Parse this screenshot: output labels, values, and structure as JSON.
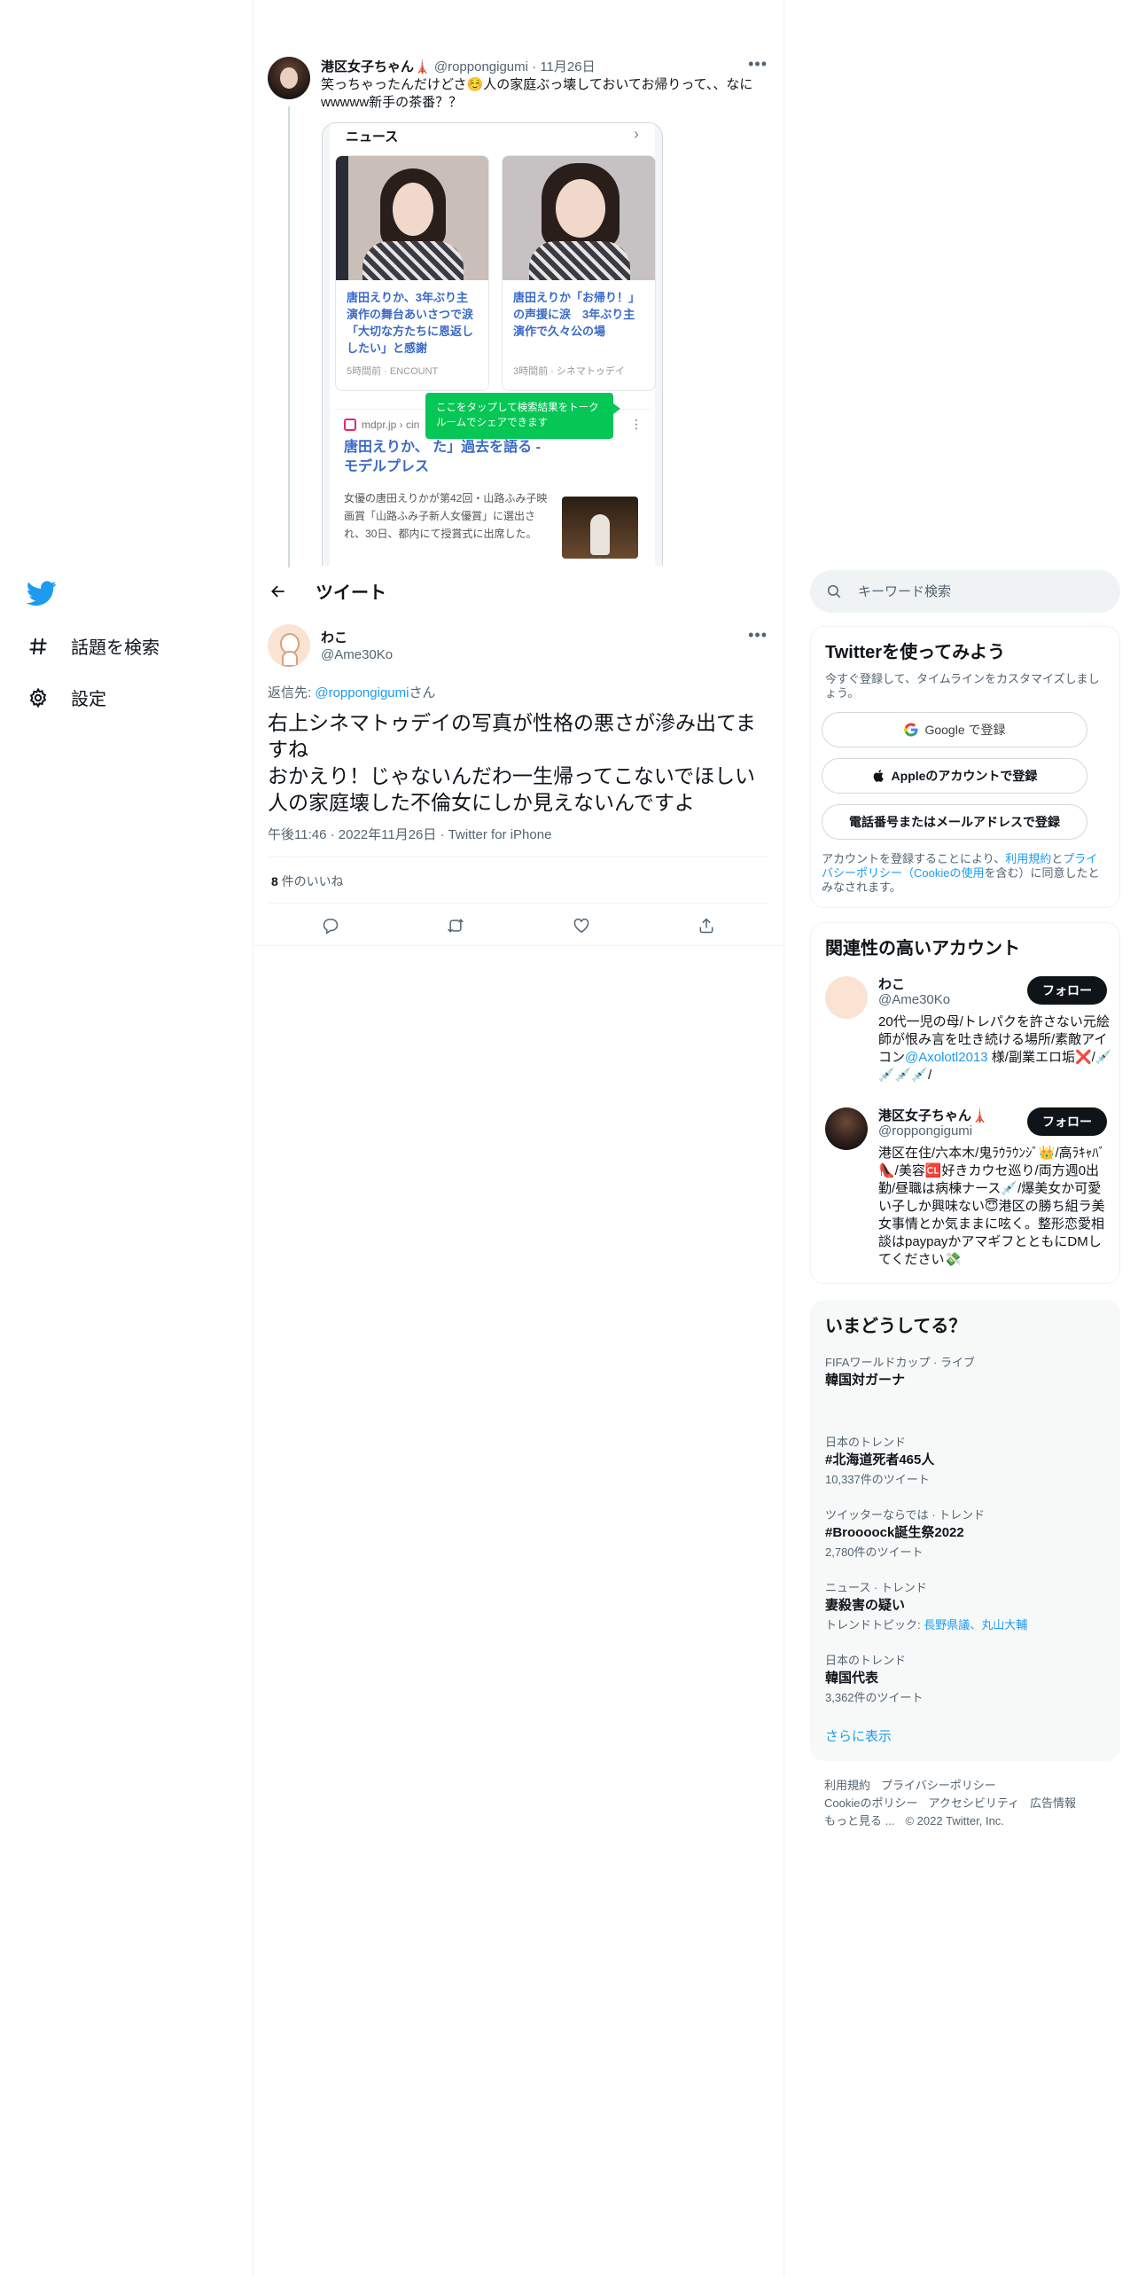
{
  "nav": {
    "explore_label": "話題を検索",
    "settings_label": "設定"
  },
  "parent_tweet": {
    "name": "港区女子ちゃん🗼",
    "handle": "@roppongigumi",
    "time": "11月26日",
    "text": "笑っちゃったんだけどさ☺️人の家庭ぶっ壊しておいてお帰りって、、なにwwwww新手の茶番？？",
    "screenshot": {
      "news_header": "ニュース",
      "card1_title": "唐田えりか、3年ぶり主演作の舞台あいさつで涙「大切な方たちに恩返ししたい」と感謝",
      "card1_source": "5時間前 · ENCOUNT",
      "card2_title": "唐田えりか「お帰り！」の声援に涙　3年ぶり主演作で久々公の場",
      "card2_source": "3時間前 · シネマトゥデイ",
      "mdpr_source": "mdpr.jp › cin",
      "mdpr_title": "唐田えりか、 た」過去を語る - モデルプレス",
      "mdpr_body": "女優の唐田えりかが第42回・山路ふみ子映画賞「山路ふみ子新人女優賞」に選出され、30日、都内にて授賞式に出席した。",
      "tooltip": "ここをタップして検索結果をトークルームでシェアできます"
    }
  },
  "header": {
    "title": "ツイート"
  },
  "tweet": {
    "name": "わこ",
    "handle": "@Ame30Ko",
    "reply_prefix": "返信先: ",
    "reply_to": "@roppongigumi",
    "reply_suffix": "さん",
    "text_line1": "右上シネマトゥデイの写真が性格の悪さが滲み出てますね",
    "text_line2": "おかえり！じゃないんだわ一生帰ってこないでほしい人の家庭壊した不倫女にしか見えないんですよ",
    "timestamp": "午後11:46 · 2022年11月26日 · Twitter for iPhone",
    "likes_count": "8",
    "likes_label": " 件のいいね"
  },
  "search": {
    "placeholder": "キーワード検索"
  },
  "signup": {
    "title": "Twitterを使ってみよう",
    "subtitle": "今すぐ登録して、タイムラインをカスタマイズしましょう。",
    "google_label": "Google で登録",
    "apple_label": "Appleのアカウントで登録",
    "phone_label": "電話番号またはメールアドレスで登録",
    "legal_1": "アカウントを登録することにより、",
    "legal_link1": "利用規約",
    "legal_2": "と",
    "legal_link2": "プライバシーポリシー（Cookieの使用",
    "legal_3": "を含む）に同意したとみなされます。"
  },
  "who_to_follow": {
    "title": "関連性の高いアカウント",
    "follow_label": "フォロー",
    "users": [
      {
        "name": "わこ",
        "handle": "@Ame30Ko",
        "bio_1": "20代一児の母/トレパクを許さない元絵師が恨み言を吐き続ける場所/素敵アイコン",
        "bio_link": "@Axolotl2013",
        "bio_2": " 様/副業エロ垢❌/💉💉💉💉/"
      },
      {
        "name": "港区女子ちゃん🗼",
        "handle": "@roppongigumi",
        "bio": "港区在住/六本木/鬼ﾗｳﾗｳﾝｼﾞ👑/高ﾗｷｬﾊﾞ👠/美容🆑好きカウセ巡り/両方週0出勤/昼職は病棟ナース💉/爆美女か可愛い子しか興味ない😇港区の勝ち組ラ美女事情とか気ままに呟く。整形恋愛相談はpaypayかアマギフとともにDMしてください💸"
      }
    ]
  },
  "trends": {
    "title": "いまどうしてる？",
    "items": [
      {
        "category": "FIFAワールドカップ · ライブ",
        "name": "韓国対ガーナ",
        "count": ""
      },
      {
        "category": "日本のトレンド",
        "name": "#北海道死者465人",
        "count": "10,337件のツイート"
      },
      {
        "category": "ツイッターならでは · トレンド",
        "name": "#Broooock誕生祭2022",
        "count": "2,780件のツイート"
      },
      {
        "category": "ニュース · トレンド",
        "name": "妻殺害の疑い",
        "count_prefix": "トレンドトピック: ",
        "count_link": "長野県議、丸山大輔"
      },
      {
        "category": "日本のトレンド",
        "name": "韓国代表",
        "count": "3,362件のツイート"
      }
    ],
    "show_more": "さらに表示"
  },
  "footer": {
    "terms": "利用規約",
    "privacy": "プライバシーポリシー",
    "cookies": "Cookieのポリシー",
    "accessibility": "アクセシビリティ",
    "ads": "広告情報",
    "more": "もっと見る ...",
    "copyright": "© 2022 Twitter, Inc."
  },
  "colors": {
    "accent": "#1d9bf0",
    "text": "#0f1419",
    "secondary": "#536471",
    "tooltip_green": "#06c755"
  }
}
